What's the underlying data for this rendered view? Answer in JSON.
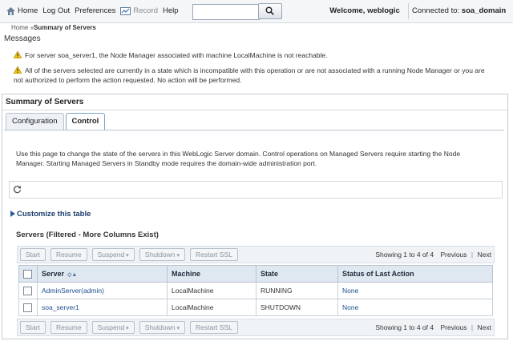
{
  "top": {
    "links": [
      {
        "label": "Home"
      },
      {
        "label": "Log Out"
      },
      {
        "label": "Preferences"
      },
      {
        "label": "Record"
      },
      {
        "label": "Help"
      }
    ],
    "search_value": "",
    "welcome": "Welcome, weblogic",
    "connected_label": "Connected to:",
    "connected_domain": "soa_domain"
  },
  "breadcrumb": {
    "home": "Home",
    "sep": " »",
    "current": "Summary of Servers"
  },
  "messages": {
    "title": "Messages",
    "items": [
      "For server soa_server1, the Node Manager associated with machine LocalMachine is not reachable.",
      "All of the servers selected are currently in a state which is incompatible with this operation or are not associated with a running Node Manager or you are not authorized to perform the action requested. No action will be performed."
    ]
  },
  "panel": {
    "title": "Summary of Servers",
    "tabs": [
      {
        "label": "Configuration"
      },
      {
        "label": "Control"
      }
    ],
    "description": "Use this page to change the state of the servers in this WebLogic Server domain. Control operations on Managed Servers require starting the Node Manager. Starting Managed Servers in Standby mode requires the domain-wide administration port.",
    "customize": "Customize this table",
    "table_title": "Servers (Filtered - More Columns Exist)",
    "buttons": {
      "start": "Start",
      "resume": "Resume",
      "suspend": "Suspend",
      "shutdown": "Shutdown",
      "restart_ssl": "Restart SSL"
    },
    "pager": {
      "showing": "Showing 1 to 4 of 4",
      "previous": "Previous",
      "next": "Next"
    },
    "columns": [
      "Server",
      "Machine",
      "State",
      "Status of Last Action"
    ],
    "rows": [
      {
        "server": "AdminServer(admin)",
        "machine": "LocalMachine",
        "state": "RUNNING",
        "status": "None"
      },
      {
        "server": "soa_server1",
        "machine": "LocalMachine",
        "state": "SHUTDOWN",
        "status": "None"
      }
    ]
  }
}
